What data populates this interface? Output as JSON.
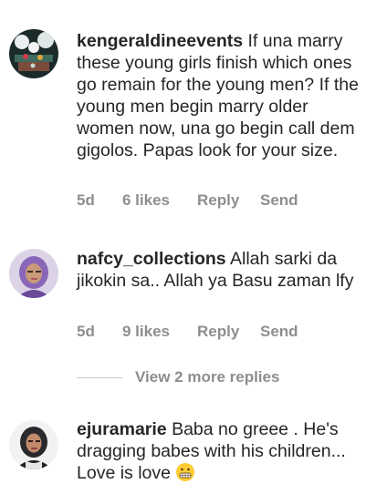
{
  "comments": [
    {
      "username": "kengeraldineevents",
      "text": "If una marry these young girls finish which ones go remain for the young men? If the young men begin marry older women now, una go begin call dem gigolos. Papas look for your size.",
      "time": "5d",
      "likes": "6 likes",
      "reply_label": "Reply",
      "send_label": "Send",
      "avatar_icon": "event-decor-avatar"
    },
    {
      "username": "nafcy_collections",
      "text": "Allah sarki  da jikokin sa.. Allah ya Basu zaman lfy",
      "time": "5d",
      "likes": "9 likes",
      "reply_label": "Reply",
      "send_label": "Send",
      "avatar_icon": "woman-hijab-avatar"
    },
    {
      "username": "ejuramarie",
      "text": "Baba no greee . He's dragging babes with his children... Love is love",
      "emoji": "grimacing-face-emoji",
      "avatar_icon": "woman-headscarf-avatar"
    }
  ],
  "view_replies_label": "View 2 more replies",
  "colors": {
    "text": "#262626",
    "secondary": "#8e8e8e",
    "divider": "#c7c7c7",
    "background": "#ffffff"
  }
}
